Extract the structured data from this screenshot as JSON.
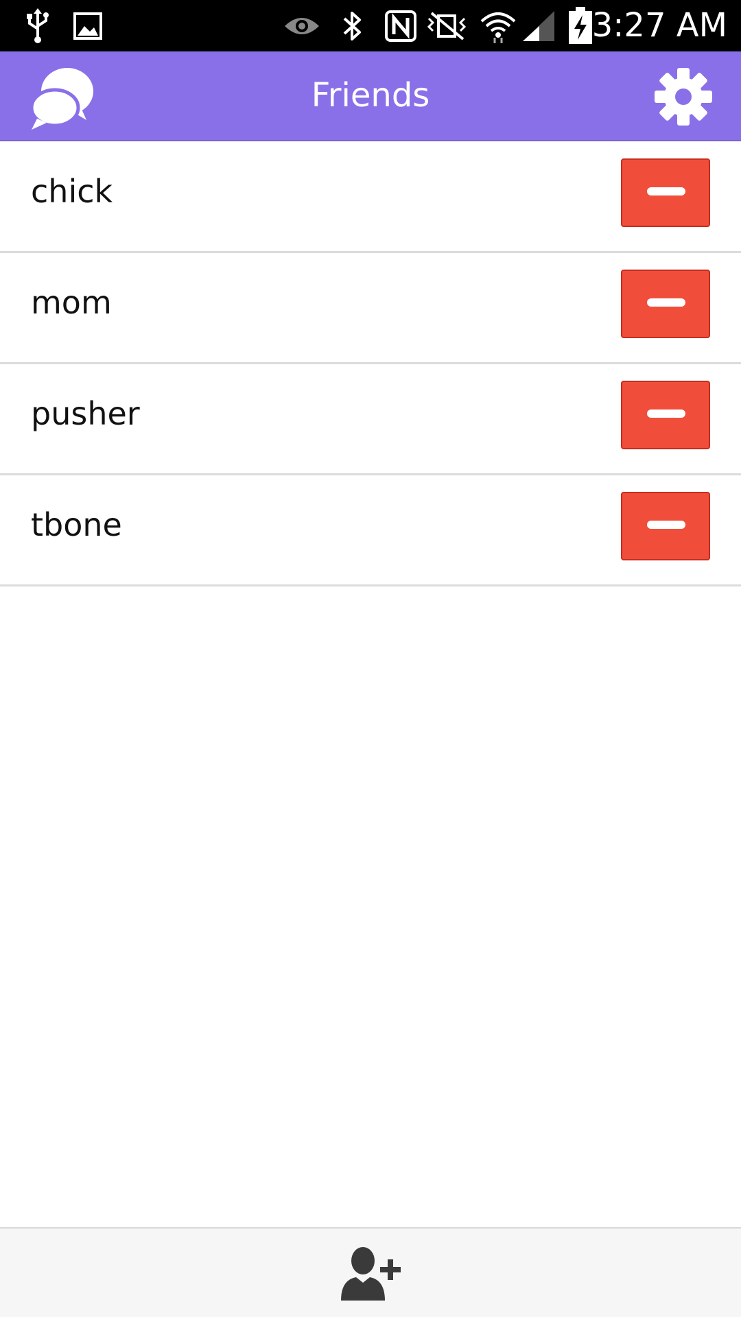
{
  "status_bar": {
    "time": "3:27 AM",
    "icons": [
      "usb-icon",
      "image-icon",
      "eye-icon",
      "bluetooth-icon",
      "nfc-icon",
      "vibrate-icon",
      "wifi-icon",
      "signal-icon",
      "battery-charging-icon"
    ]
  },
  "app_bar": {
    "title": "Friends",
    "left_icon": "chat-bubbles-icon",
    "right_icon": "gear-icon",
    "color": "#8a70e8"
  },
  "friends": [
    {
      "name": "chick"
    },
    {
      "name": "mom"
    },
    {
      "name": "pusher"
    },
    {
      "name": "tbone"
    }
  ],
  "remove_button": {
    "icon": "minus-icon",
    "color": "#f04e3a"
  },
  "bottom_bar": {
    "icon": "add-person-icon"
  }
}
